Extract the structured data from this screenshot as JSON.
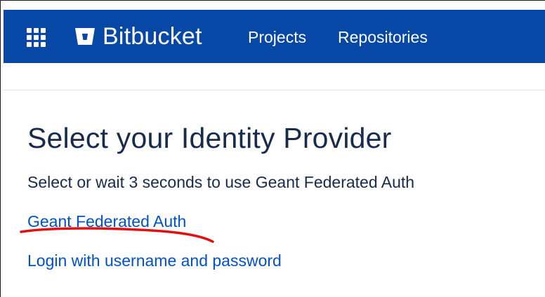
{
  "header": {
    "app_name": "Bitbucket",
    "nav": [
      {
        "label": "Projects"
      },
      {
        "label": "Repositories"
      }
    ]
  },
  "main": {
    "title": "Select your Identity Provider",
    "subtitle": "Select or wait 3 seconds to use Geant Federated Auth",
    "providers": [
      {
        "label": "Geant Federated Auth"
      },
      {
        "label": "Login with username and password"
      }
    ]
  },
  "colors": {
    "navbar": "#0747a6",
    "link": "#0052cc",
    "text": "#172b4d",
    "annotation": "#e01010"
  },
  "icons": {
    "app_switcher": "grid-icon",
    "logo": "bitbucket-logo-icon"
  }
}
